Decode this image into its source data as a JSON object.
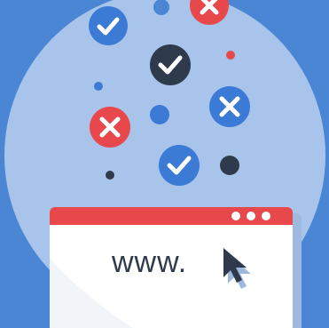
{
  "illustration": {
    "browser": {
      "address_text": "www."
    },
    "colors": {
      "background": "#4a86d4",
      "circle": "#a9c4ea",
      "check_blue": "#3b7bd6",
      "check_dark": "#2f3b4c",
      "error_red": "#e8474c",
      "window_header": "#e8474c",
      "window_body": "#ffffff",
      "window_shadow": "#9fb8de"
    },
    "icons": [
      "check-icon",
      "check-icon",
      "check-icon",
      "cross-icon",
      "cross-icon",
      "cursor-icon",
      "window-dots-icon"
    ]
  }
}
